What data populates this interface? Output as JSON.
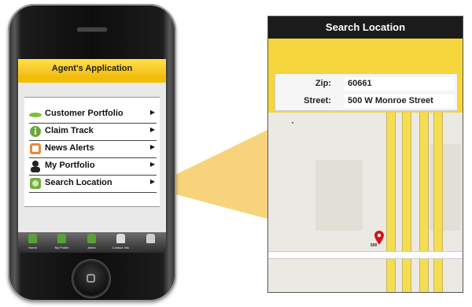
{
  "app": {
    "title": "Agent's Application",
    "menu": [
      {
        "label": "Customer Portfolio",
        "icon": "leaf-icon"
      },
      {
        "label": "Claim Track",
        "icon": "info-icon"
      },
      {
        "label": "News Alerts",
        "icon": "news-icon"
      },
      {
        "label": "My Portfolio",
        "icon": "person-icon"
      },
      {
        "label": "Search Location",
        "icon": "globe-icon"
      }
    ],
    "arrow": "▶",
    "tabs": [
      "Home",
      "My Profile",
      "Alerts",
      "Contact Info"
    ]
  },
  "search": {
    "title": "Search Location",
    "zip_label": "Zip:",
    "zip_value": "60661",
    "street_label": "Street:",
    "street_value": "500 W Monroe Street",
    "pin_label": "500"
  },
  "colors": {
    "accent_yellow": "#f5d63c",
    "header_dark": "#1b1b1b",
    "pin_red": "#d0141c",
    "dot_green": "#8dbd3c"
  }
}
